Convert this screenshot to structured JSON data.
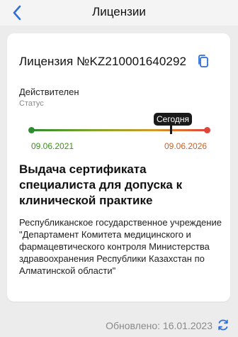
{
  "header": {
    "title": "Лицензии",
    "back_icon": "chevron-left-icon",
    "accent_color": "#2f6fd8"
  },
  "license": {
    "number": "Лицензия №KZ210001640292",
    "copy_icon": "copy-icon",
    "status_value": "Действителен",
    "status_label": "Статус",
    "timeline": {
      "start_date": "09.06.2021",
      "end_date": "09.06.2026",
      "today_label": "Сегодня",
      "today_progress": 0.79,
      "colors": {
        "start": "#2e8b2e",
        "end": "#e0443a"
      }
    },
    "title": "Выдача сертификата специалиста для допуска к клинической практике",
    "issuer": "Республиканское государственное учреждение \"Департамент Комитета медицинского и фармацевтического контроля Министерства здравоохранения Республики Казахстан по Алматинской области\""
  },
  "footer": {
    "updated": "Обновлено: 16.01.2023",
    "refresh_icon": "refresh-icon"
  }
}
